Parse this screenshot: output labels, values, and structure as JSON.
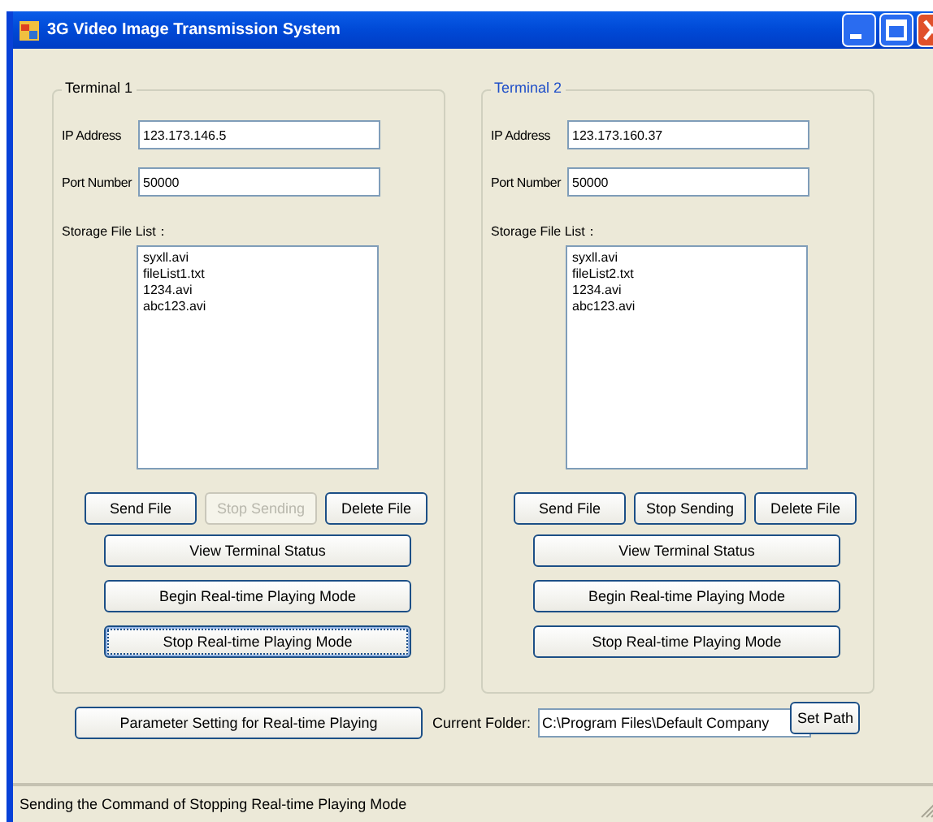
{
  "window": {
    "title": "3G Video Image Transmission System"
  },
  "terminals": [
    {
      "title": "Terminal 1",
      "color": "#000000",
      "fields": [
        {
          "label": "IP Address",
          "value": "123.173.146.5"
        },
        {
          "label": "Port Number",
          "value": "50000"
        }
      ],
      "list_label": "Storage File List：",
      "files": [
        "syxll.avi",
        "fileList1.txt",
        "1234.avi",
        "abc123.avi"
      ],
      "file_buttons": [
        {
          "label": "Send File",
          "disabled": false
        },
        {
          "label": "Stop Sending",
          "disabled": true
        },
        {
          "label": "Delete File",
          "disabled": false
        }
      ],
      "mode_buttons": [
        {
          "label": "View Terminal Status",
          "focused": false
        },
        {
          "label": "Begin Real-time Playing Mode",
          "focused": false
        },
        {
          "label": "Stop Real-time Playing Mode",
          "focused": true
        }
      ]
    },
    {
      "title": "Terminal 2",
      "color": "#1f4fc8",
      "fields": [
        {
          "label": "IP Address",
          "value": "123.173.160.37"
        },
        {
          "label": "Port Number",
          "value": "50000"
        }
      ],
      "list_label": "Storage File List：",
      "files": [
        "syxll.avi",
        "fileList2.txt",
        "1234.avi",
        "abc123.avi"
      ],
      "file_buttons": [
        {
          "label": "Send File",
          "disabled": false
        },
        {
          "label": "Stop Sending",
          "disabled": false
        },
        {
          "label": "Delete File",
          "disabled": false
        }
      ],
      "mode_buttons": [
        {
          "label": "View Terminal Status",
          "focused": false
        },
        {
          "label": "Begin Real-time Playing Mode",
          "focused": false
        },
        {
          "label": "Stop Real-time Playing Mode",
          "focused": false
        }
      ]
    }
  ],
  "parameter_button": "Parameter Setting for Real-time Playing",
  "folder": {
    "label": "Current Folder:",
    "value": "C:\\Program Files\\Default Company"
  },
  "set_path_button": "Set Path",
  "status_bar": "Sending the Command of Stopping Real-time Playing Mode"
}
